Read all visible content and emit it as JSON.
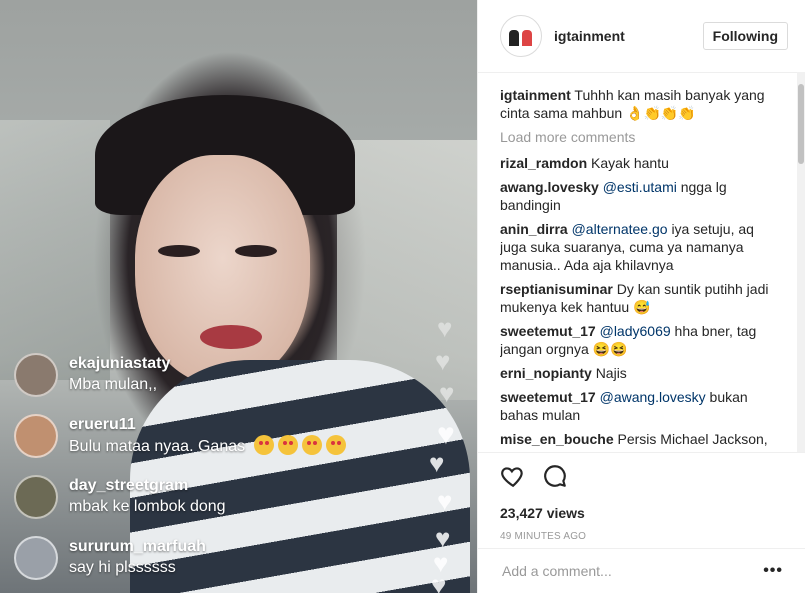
{
  "video": {
    "comments": [
      {
        "user": "ekajuniastaty",
        "message": "Mba mulan,,",
        "avatar_color": "#8a7a6e",
        "emojis": 0
      },
      {
        "user": "erueru11",
        "message": "Bulu mataa nyaa. Ganas",
        "avatar_color": "#c09070",
        "emojis": 4
      },
      {
        "user": "day_streetgram",
        "message": "mbak ke lombok dong",
        "avatar_color": "#6c6a55",
        "emojis": 0
      },
      {
        "user": "sururum_marfuah",
        "message": "say hi plssssss",
        "avatar_color": "#9aa0a8",
        "emojis": 0
      }
    ]
  },
  "header": {
    "username": "igtainment",
    "follow_label": "Following"
  },
  "caption": {
    "user": "igtainment",
    "text": "Tuhhh kan masih banyak yang cinta sama mahbun 👌👏👏👏"
  },
  "load_more": "Load more comments",
  "comments": [
    {
      "user": "rizal_ramdon",
      "mention": "",
      "text": "Kayak hantu"
    },
    {
      "user": "awang.lovesky",
      "mention": "@esti.utami",
      "text": "ngga lg bandingin"
    },
    {
      "user": "anin_dirra",
      "mention": "@alternatee.go",
      "text": "iya setuju, aq juga suka suaranya, cuma ya namanya manusia.. Ada aja khilavnya"
    },
    {
      "user": "rseptianisuminar",
      "mention": "",
      "text": "Dy kan suntik putihh jadi mukenya kek hantuu 😅"
    },
    {
      "user": "sweetemut_17",
      "mention": "@lady6069",
      "text": "hha bner, tag jangan orgnya 😆😆"
    },
    {
      "user": "erni_nopianty",
      "mention": "",
      "text": "Najis"
    },
    {
      "user": "sweetemut_17",
      "mention": "@awang.lovesky",
      "text": "bukan bahas mulan"
    },
    {
      "user": "mise_en_bouche",
      "mention": "",
      "text": "Persis Michael Jackson,"
    }
  ],
  "stats": {
    "views": "23,427 views",
    "time": "49 MINUTES AGO"
  },
  "add_comment": {
    "placeholder": "Add a comment...",
    "more": "•••"
  },
  "icons": {
    "like": "heart-outline-icon",
    "comment": "speech-bubble-icon",
    "more": "more-options-icon"
  }
}
